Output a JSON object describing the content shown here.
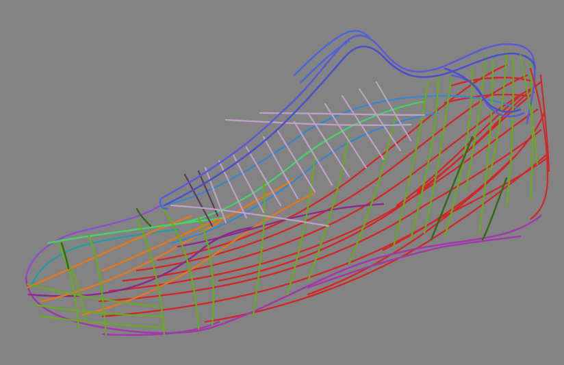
{
  "scene": {
    "background": "#838383",
    "subject": "shoe-wireframe",
    "colors": {
      "lace-tube": "#5a5ad2",
      "collar": "#4a50c8",
      "throat-edge": "#4a66d8",
      "instep-line": "#3a86c8",
      "tongue-rib": "#c0a0c8",
      "tongue-rib-shadow": "#5a3a5a",
      "sole-edge": "#a03aa8",
      "toe-outline": "#2a9aa0",
      "instep-stripe": "#4ad06a",
      "cross-green": "#6aaa22",
      "cross-green-dark": "#2e6a10",
      "long-red": "#d02828",
      "long-orange": "#e07820",
      "long-purple": "#8a2a8a"
    }
  }
}
